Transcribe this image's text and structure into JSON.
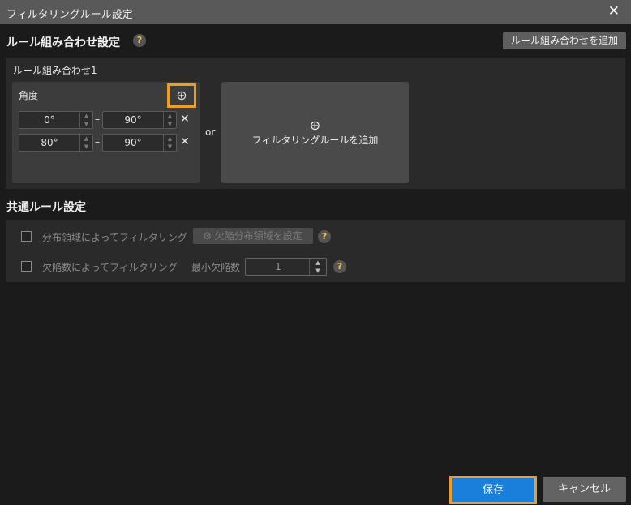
{
  "dialog": {
    "title": "フィルタリングルール設定",
    "close_icon": "close-icon"
  },
  "rules": {
    "heading": "ルール組み合わせ設定",
    "help": "?",
    "add_combo_label": "ルール組み合わせを追加",
    "combo": {
      "title": "ルール組み合わせ1",
      "rule": {
        "name": "角度",
        "ranges": [
          {
            "min": "0°",
            "max": "90°"
          },
          {
            "min": "80°",
            "max": "90°"
          }
        ],
        "dash": "–",
        "remove": "✕"
      },
      "or_label": "or",
      "add_rule_label": "フィルタリングルールを追加"
    }
  },
  "common": {
    "heading": "共通ルール設定",
    "dist": {
      "label": "分布領域によってフィルタリング",
      "button": "欠陥分布領域を設定",
      "help": "?"
    },
    "count": {
      "label": "欠陥数によってフィルタリング",
      "min_label": "最小欠陥数",
      "min_value": "1",
      "help": "?"
    }
  },
  "footer": {
    "save": "保存",
    "cancel": "キャンセル"
  },
  "colors": {
    "accent": "#1a7fdb",
    "highlight": "#f39c1f"
  }
}
